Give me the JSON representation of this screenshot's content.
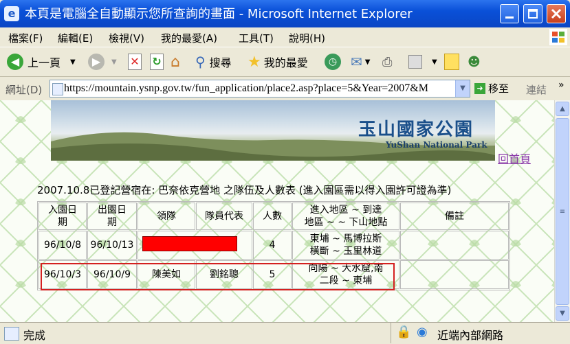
{
  "window": {
    "title": "本頁是電腦全自動顯示您所查詢的畫面 - Microsoft Internet Explorer"
  },
  "menu": [
    "檔案(F)",
    "編輯(E)",
    "檢視(V)",
    "我的最愛(A)",
    "工具(T)",
    "說明(H)"
  ],
  "toolbar": {
    "back_label": "上一頁",
    "search_label": "搜尋",
    "favorites_label": "我的最愛"
  },
  "address": {
    "label": "網址(D)",
    "url": "https://mountain.ysnp.gov.tw/fun_application/place2.asp?place=5&Year=2007&M",
    "go_label": "移至",
    "links_label": "連結",
    "more": "»"
  },
  "page": {
    "park_name": "玉山國家公園",
    "park_name_en": "YuShan National Park",
    "home_link": "回首頁",
    "caption": "2007.10.8已登記營宿在: 巴奈依克營地 之隊伍及人數表 (進入園區需以得入園許可證為準)",
    "table": {
      "headers": [
        "入園日\n期",
        "出園日\n期",
        "領隊",
        "隊員代表",
        "人數",
        "進入地區 ~ 到達\n地區 ~ ~ 下山地點",
        "備註"
      ],
      "rows": [
        [
          "96/10/8",
          "96/10/13",
          "",
          "",
          "4",
          "東埔 ~ 馬博拉斯\n橫斷 ~ 玉里林道",
          ""
        ],
        [
          "96/10/3",
          "96/10/9",
          "陳美如",
          "劉銘聰",
          "5",
          "向陽 ~ 大水窟,南\n二段 ~ 東埔",
          ""
        ]
      ]
    }
  },
  "status": {
    "text": "完成",
    "zone": "近端內部網路"
  },
  "colors": {
    "titlebar": "#0a50d8",
    "chrome": "#ece9d8",
    "highlight_border": "#d42020",
    "redaction": "#ff0000",
    "link_visited": "#8a3aa8"
  }
}
